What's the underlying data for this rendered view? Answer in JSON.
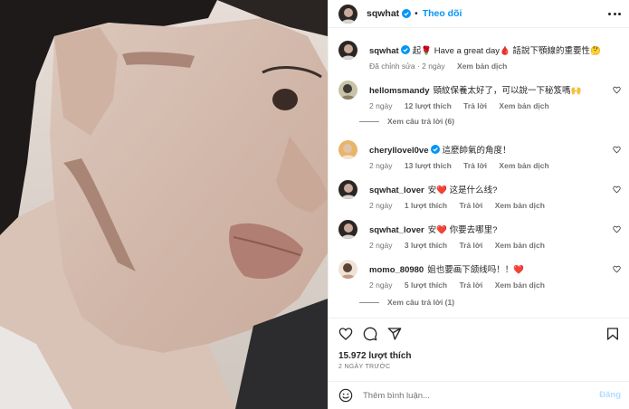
{
  "post": {
    "username": "sqwhat",
    "follow_label": "Theo dõi",
    "dot": "•",
    "caption_text": "起🌹 Have a great day🩸 話說下顎線的重要性🤔",
    "caption_meta": {
      "edited": "Đã chỉnh sửa · 2 ngày",
      "translate": "Xem bản dịch"
    }
  },
  "comments": [
    {
      "username": "hellomsmandy",
      "text": "頸紋保養太好了，可以說一下秘笈嗎🙌",
      "time": "2 ngày",
      "likes": "12 lượt thích",
      "reply": "Trả lời",
      "translate": "Xem bản dịch",
      "replies_label": "Xem câu trả lời (6)"
    },
    {
      "username": "cheryllovel0ve",
      "text": "這麼帥氣的角度！",
      "time": "2 ngày",
      "likes": "13 lượt thích",
      "reply": "Trả lời",
      "translate": "Xem bản dịch"
    },
    {
      "username": "sqwhat_lover",
      "text": "安❤️ 这是什么线?",
      "time": "2 ngày",
      "likes": "1 lượt thích",
      "reply": "Trả lời",
      "translate": "Xem bản dịch"
    },
    {
      "username": "sqwhat_lover",
      "text": "安❤️ 你要去哪里?",
      "time": "2 ngày",
      "likes": "3 lượt thích",
      "reply": "Trả lời",
      "translate": "Xem bản dịch"
    },
    {
      "username": "momo_80980",
      "text": "姐也要画下颌线吗！！❤️",
      "time": "2 ngày",
      "likes": "5 lượt thích",
      "reply": "Trả lời",
      "translate": "Xem bản dịch",
      "replies_label": "Xem câu trả lời (1)"
    }
  ],
  "stats": {
    "likes": "15.972 lượt thích",
    "ago": "2 NGÀY TRƯỚC"
  },
  "add_comment": {
    "placeholder": "Thêm bình luận...",
    "post_label": "Đăng"
  },
  "colors": {
    "accent": "#0095f6",
    "post_disabled": "#b2dffc",
    "verified": "#0095f6"
  },
  "icons": [
    "more-icon",
    "heart-icon",
    "comment-icon",
    "share-icon",
    "bookmark-icon",
    "emoji-icon",
    "verified-icon"
  ]
}
